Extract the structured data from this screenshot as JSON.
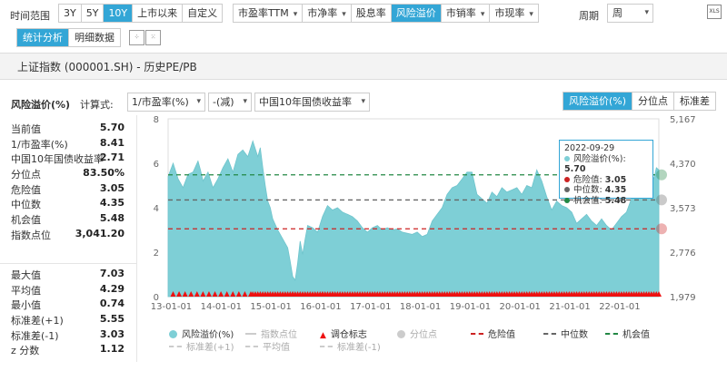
{
  "filters": {
    "range_label": "时间范围",
    "ranges": [
      "3Y",
      "5Y",
      "10Y",
      "上市以来",
      "自定义"
    ],
    "active_range": "10Y",
    "metrics": [
      "市盈率TTM",
      "市净率",
      "股息率",
      "风险溢价",
      "市销率",
      "市现率"
    ],
    "active_metric": "风险溢价",
    "period_label": "周期",
    "period_value": "周",
    "export_icon": "excel-icon",
    "view_tabs": [
      "统计分析",
      "明细数据"
    ],
    "active_view": "统计分析",
    "zoom_icons": [
      "expand-icon",
      "collapse-icon"
    ]
  },
  "title": "上证指数 (000001.SH) - 历史PE/PB",
  "controls": {
    "series_label": "风险溢价(%)",
    "formula_label": "计算式:",
    "select1": "1/市盈率(%)",
    "select2": "-(减)",
    "select3": "中国10年国债收益率",
    "right_tabs": [
      "风险溢价(%)",
      "分位点",
      "标准差"
    ],
    "active_right_tab": "风险溢价(%)"
  },
  "stats_top": [
    {
      "k": "当前值",
      "v": "5.70"
    },
    {
      "k": "1/市盈率(%)",
      "v": "8.41"
    },
    {
      "k": "中国10年国债收益率",
      "v": "2.71"
    },
    {
      "k": "分位点",
      "v": "83.50%"
    },
    {
      "k": "危险值",
      "v": "3.05"
    },
    {
      "k": "中位数",
      "v": "4.35"
    },
    {
      "k": "机会值",
      "v": "5.48"
    },
    {
      "k": "指数点位",
      "v": "3,041.20"
    }
  ],
  "stats_bottom": [
    {
      "k": "最大值",
      "v": "7.03"
    },
    {
      "k": "平均值",
      "v": "4.29"
    },
    {
      "k": "最小值",
      "v": "0.74"
    },
    {
      "k": "标准差(+1)",
      "v": "5.55"
    },
    {
      "k": "标准差(-1)",
      "v": "3.03"
    },
    {
      "k": "z 分数",
      "v": "1.12"
    }
  ],
  "tooltip": {
    "date": "2022-09-29",
    "rows": [
      {
        "k": "风险溢价(%)",
        "v": "5.70",
        "color": "#7ecfd6"
      },
      {
        "k": "危险值",
        "v": "3.05",
        "color": "#cc2222"
      },
      {
        "k": "中位数",
        "v": "4.35",
        "color": "#666666"
      },
      {
        "k": "机会值",
        "v": "5.48",
        "color": "#228844"
      }
    ]
  },
  "legend": {
    "row1": [
      "风险溢价(%)",
      "指数点位",
      "调仓标志",
      "分位点",
      "危险值",
      "中位数",
      "机会值"
    ],
    "row2": [
      "标准差(+1)",
      "平均值",
      "标准差(-1)"
    ]
  },
  "colors": {
    "accent": "#33a6d6",
    "area": "#7ecfd6",
    "danger": "#cc2222",
    "median": "#666666",
    "chance": "#228844",
    "marker": "#ee1111"
  },
  "chart_data": {
    "type": "area",
    "x_ticks": [
      "13-01-01",
      "14-01-01",
      "15-01-01",
      "16-01-01",
      "17-01-01",
      "18-01-01",
      "19-01-01",
      "20-01-01",
      "21-01-01",
      "22-01-01"
    ],
    "y_left_ticks": [
      "0",
      "2",
      "4",
      "6",
      "8"
    ],
    "y_right_ticks": [
      "1,979",
      "2,776",
      "3,573",
      "4,370",
      "5,167"
    ],
    "ylim": [
      0,
      8
    ],
    "x_start": 2012.9,
    "x_end": 2022.75,
    "series": [
      {
        "name": "风险溢价(%)",
        "points": [
          [
            2012.9,
            5.4
          ],
          [
            2013.0,
            6.0
          ],
          [
            2013.1,
            5.3
          ],
          [
            2013.2,
            4.9
          ],
          [
            2013.3,
            5.5
          ],
          [
            2013.4,
            5.6
          ],
          [
            2013.5,
            6.1
          ],
          [
            2013.55,
            5.7
          ],
          [
            2013.6,
            5.2
          ],
          [
            2013.7,
            5.6
          ],
          [
            2013.8,
            4.9
          ],
          [
            2013.9,
            5.3
          ],
          [
            2014.0,
            5.8
          ],
          [
            2014.1,
            6.2
          ],
          [
            2014.2,
            5.6
          ],
          [
            2014.3,
            6.4
          ],
          [
            2014.4,
            6.6
          ],
          [
            2014.5,
            6.3
          ],
          [
            2014.6,
            7.0
          ],
          [
            2014.7,
            6.3
          ],
          [
            2014.75,
            6.7
          ],
          [
            2014.8,
            5.8
          ],
          [
            2014.85,
            5.0
          ],
          [
            2014.9,
            4.3
          ],
          [
            2014.95,
            4.0
          ],
          [
            2015.0,
            3.5
          ],
          [
            2015.1,
            3.0
          ],
          [
            2015.2,
            2.6
          ],
          [
            2015.3,
            2.2
          ],
          [
            2015.35,
            1.6
          ],
          [
            2015.4,
            0.9
          ],
          [
            2015.45,
            0.74
          ],
          [
            2015.5,
            1.5
          ],
          [
            2015.55,
            2.5
          ],
          [
            2015.6,
            1.9
          ],
          [
            2015.65,
            2.6
          ],
          [
            2015.7,
            3.2
          ],
          [
            2015.8,
            3.1
          ],
          [
            2015.9,
            2.9
          ],
          [
            2016.0,
            3.6
          ],
          [
            2016.1,
            4.1
          ],
          [
            2016.2,
            3.9
          ],
          [
            2016.3,
            4.0
          ],
          [
            2016.4,
            3.8
          ],
          [
            2016.5,
            3.7
          ],
          [
            2016.6,
            3.6
          ],
          [
            2016.7,
            3.4
          ],
          [
            2016.8,
            3.1
          ],
          [
            2016.9,
            2.9
          ],
          [
            2017.0,
            3.1
          ],
          [
            2017.1,
            3.2
          ],
          [
            2017.2,
            3.0
          ],
          [
            2017.3,
            3.1
          ],
          [
            2017.4,
            3.0
          ],
          [
            2017.5,
            3.05
          ],
          [
            2017.6,
            2.9
          ],
          [
            2017.7,
            2.85
          ],
          [
            2017.8,
            2.8
          ],
          [
            2017.9,
            2.9
          ],
          [
            2018.0,
            2.7
          ],
          [
            2018.1,
            2.8
          ],
          [
            2018.2,
            3.4
          ],
          [
            2018.3,
            3.7
          ],
          [
            2018.4,
            4.0
          ],
          [
            2018.5,
            4.6
          ],
          [
            2018.6,
            4.9
          ],
          [
            2018.7,
            5.0
          ],
          [
            2018.8,
            5.3
          ],
          [
            2018.9,
            5.6
          ],
          [
            2019.0,
            5.6
          ],
          [
            2019.1,
            4.6
          ],
          [
            2019.2,
            4.4
          ],
          [
            2019.3,
            4.2
          ],
          [
            2019.4,
            4.7
          ],
          [
            2019.5,
            4.5
          ],
          [
            2019.6,
            4.9
          ],
          [
            2019.7,
            4.7
          ],
          [
            2019.8,
            4.8
          ],
          [
            2019.9,
            4.9
          ],
          [
            2020.0,
            4.6
          ],
          [
            2020.1,
            5.0
          ],
          [
            2020.2,
            4.9
          ],
          [
            2020.3,
            5.7
          ],
          [
            2020.4,
            5.2
          ],
          [
            2020.5,
            4.5
          ],
          [
            2020.6,
            3.9
          ],
          [
            2020.7,
            4.3
          ],
          [
            2020.8,
            4.1
          ],
          [
            2020.9,
            4.0
          ],
          [
            2021.0,
            3.8
          ],
          [
            2021.1,
            3.3
          ],
          [
            2021.2,
            3.5
          ],
          [
            2021.3,
            3.7
          ],
          [
            2021.4,
            3.4
          ],
          [
            2021.5,
            3.2
          ],
          [
            2021.6,
            3.5
          ],
          [
            2021.7,
            3.2
          ],
          [
            2021.8,
            3.0
          ],
          [
            2021.9,
            3.3
          ],
          [
            2022.0,
            3.6
          ],
          [
            2022.1,
            3.8
          ],
          [
            2022.2,
            4.4
          ],
          [
            2022.3,
            5.2
          ],
          [
            2022.35,
            6.0
          ],
          [
            2022.4,
            5.5
          ],
          [
            2022.5,
            5.0
          ],
          [
            2022.55,
            5.3
          ],
          [
            2022.6,
            5.6
          ],
          [
            2022.65,
            5.3
          ],
          [
            2022.7,
            5.8
          ],
          [
            2022.75,
            5.7
          ]
        ]
      }
    ],
    "reference_lines": [
      {
        "name": "机会值",
        "value": 5.48
      },
      {
        "name": "中位数",
        "value": 4.35
      },
      {
        "name": "危险值",
        "value": 3.05
      }
    ],
    "markers": {
      "name": "调仓标志",
      "ranges": [
        [
          2013.0,
          2014.6
        ],
        [
          2015.4,
          2015.5
        ],
        [
          2016.0,
          2016.05
        ],
        [
          2016.2,
          2016.3
        ]
      ],
      "dense_from": 2014.6,
      "dense_to": 2022.75
    }
  }
}
